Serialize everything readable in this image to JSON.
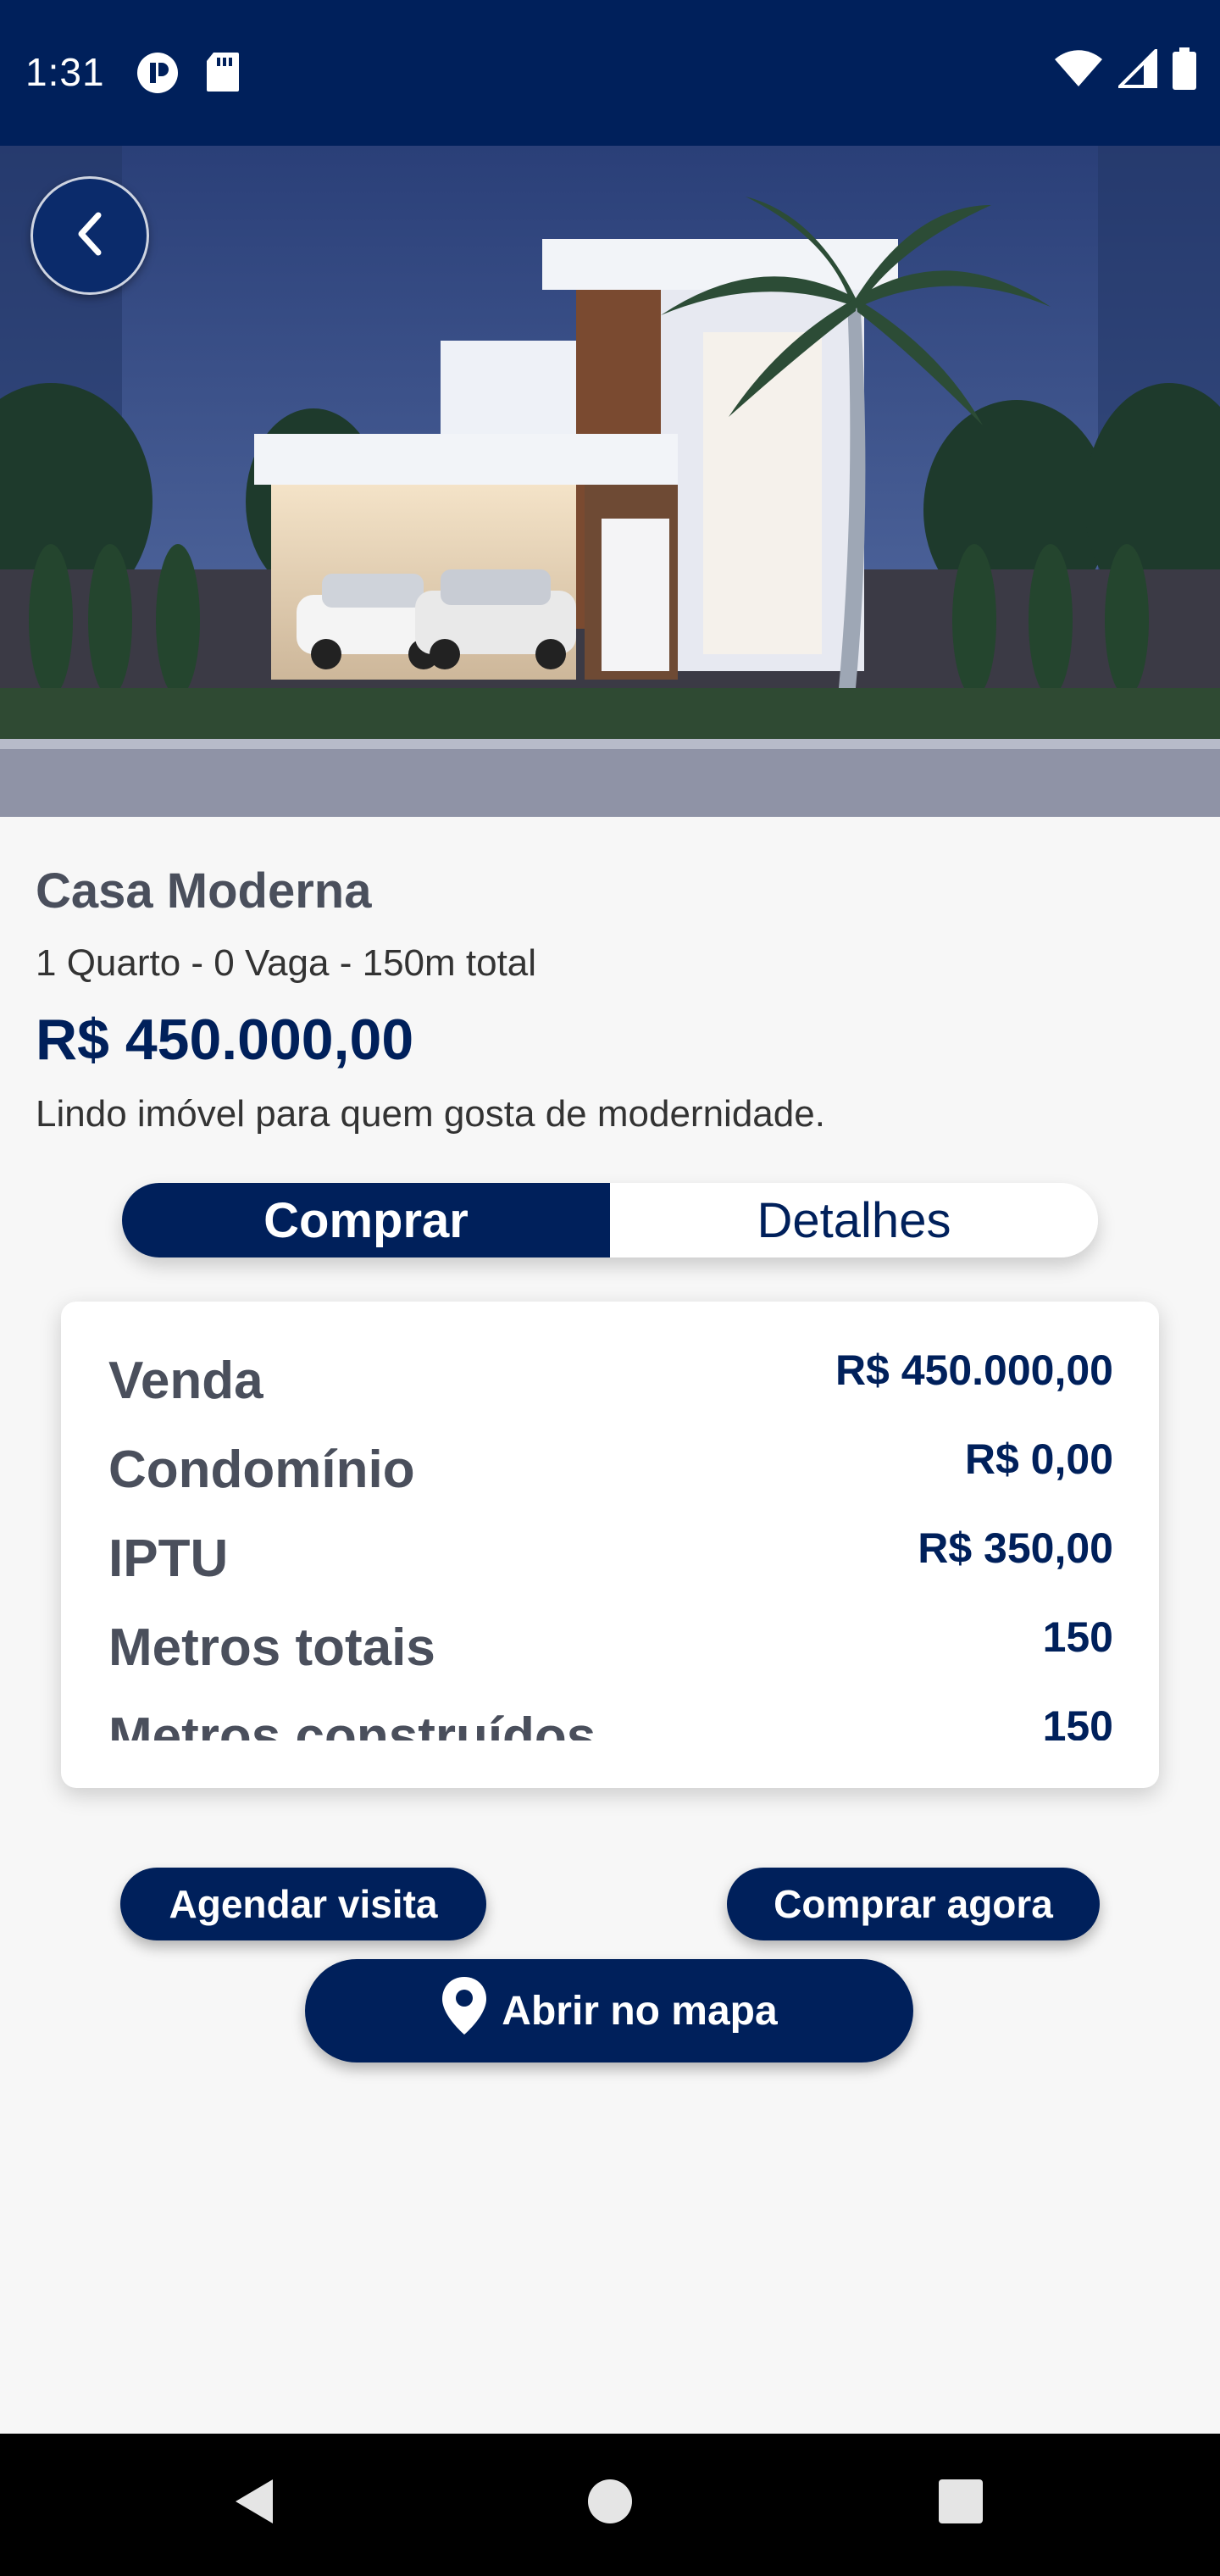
{
  "status_bar": {
    "time": "1:31",
    "icons": [
      "privacy-icon",
      "sd-card-icon",
      "wifi-icon",
      "signal-icon",
      "battery-icon"
    ]
  },
  "hero": {
    "image_alt": "Casa Moderna"
  },
  "property": {
    "title": "Casa Moderna",
    "summary": "1 Quarto - 0 Vaga - 150m total",
    "price": "R$ 450.000,00",
    "description": "Lindo imóvel para quem gosta de modernidade."
  },
  "tabs": [
    {
      "label": "Comprar",
      "active": true
    },
    {
      "label": "Detalhes",
      "active": false
    }
  ],
  "details": {
    "rows": [
      {
        "label": "Venda",
        "value": "R$ 450.000,00"
      },
      {
        "label": "Condomínio",
        "value": "R$ 0,00"
      },
      {
        "label": "IPTU",
        "value": "R$ 350,00"
      },
      {
        "label": "Metros totais",
        "value": "150"
      },
      {
        "label": "Metros construídos",
        "value": "150"
      }
    ]
  },
  "actions": {
    "schedule_label": "Agendar visita",
    "buy_label": "Comprar agora",
    "map_label": "Abrir no mapa"
  },
  "colors": {
    "primary": "#00205b",
    "background": "#f7f7f7",
    "title_gray": "#4a4f5c"
  }
}
